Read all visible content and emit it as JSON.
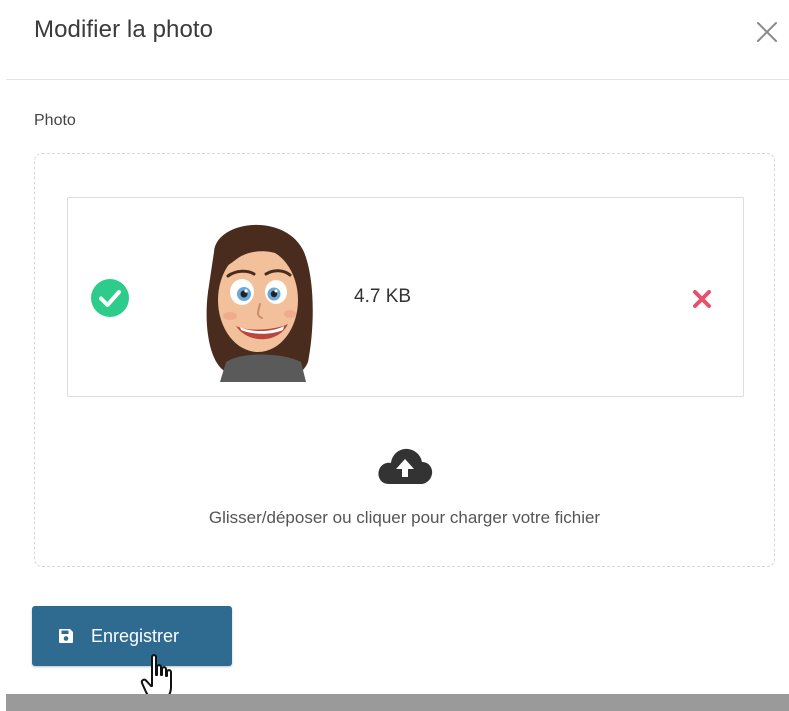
{
  "dialog": {
    "title": "Modifier la photo",
    "close_icon": "close-icon"
  },
  "form": {
    "photo_label": "Photo"
  },
  "dropzone": {
    "file": {
      "status_icon": "check-circle-icon",
      "preview": "avatar-thumbnail",
      "size": "4.7 KB",
      "remove_icon": "remove-x-icon"
    },
    "upload_icon": "cloud-upload-icon",
    "hint": "Glisser/déposer ou cliquer pour charger votre fichier"
  },
  "actions": {
    "save_label": "Enregistrer",
    "save_icon": "floppy-disk-icon"
  },
  "colors": {
    "primary": "#2f6a91",
    "success": "#2ecc8b",
    "danger": "#e8516b",
    "text": "#333333"
  }
}
